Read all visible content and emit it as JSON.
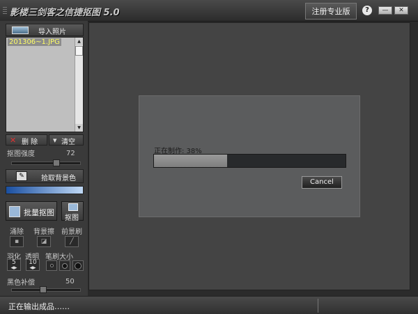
{
  "app": {
    "title": "影楼三剑客之信捷抠图 5.0",
    "register_label": "注册专业版",
    "help_label": "?",
    "minimize_label": "—",
    "close_label": "✕"
  },
  "sidebar": {
    "import_label": "导入照片",
    "files": [
      "201306~1.JPG"
    ],
    "delete_label": "删 除",
    "clear_label": "清空",
    "strength_label": "抠图强度",
    "strength_value": "72",
    "pick_bg_label": "拾取背景色",
    "batch_label": "批量抠图",
    "cut_label": "抠图",
    "tools": {
      "erase": "涌除",
      "bg_brush": "背景擦",
      "fg_brush": "前景刷"
    },
    "feather_label": "羽化",
    "feather_value": "5",
    "opacity_label": "透明",
    "opacity_value": "10",
    "brush_size_label": "笔刷大小",
    "black_comp_label": "黑色补偿",
    "black_comp_value": "50"
  },
  "dialog": {
    "message": "正在制作: 38%",
    "progress": 0.38,
    "cancel_label": "Cancel"
  },
  "status": {
    "text": "正在输出成品……"
  },
  "colors": {
    "accent_blue": "#3a6fc0",
    "file_selected_text": "#ffff66"
  }
}
